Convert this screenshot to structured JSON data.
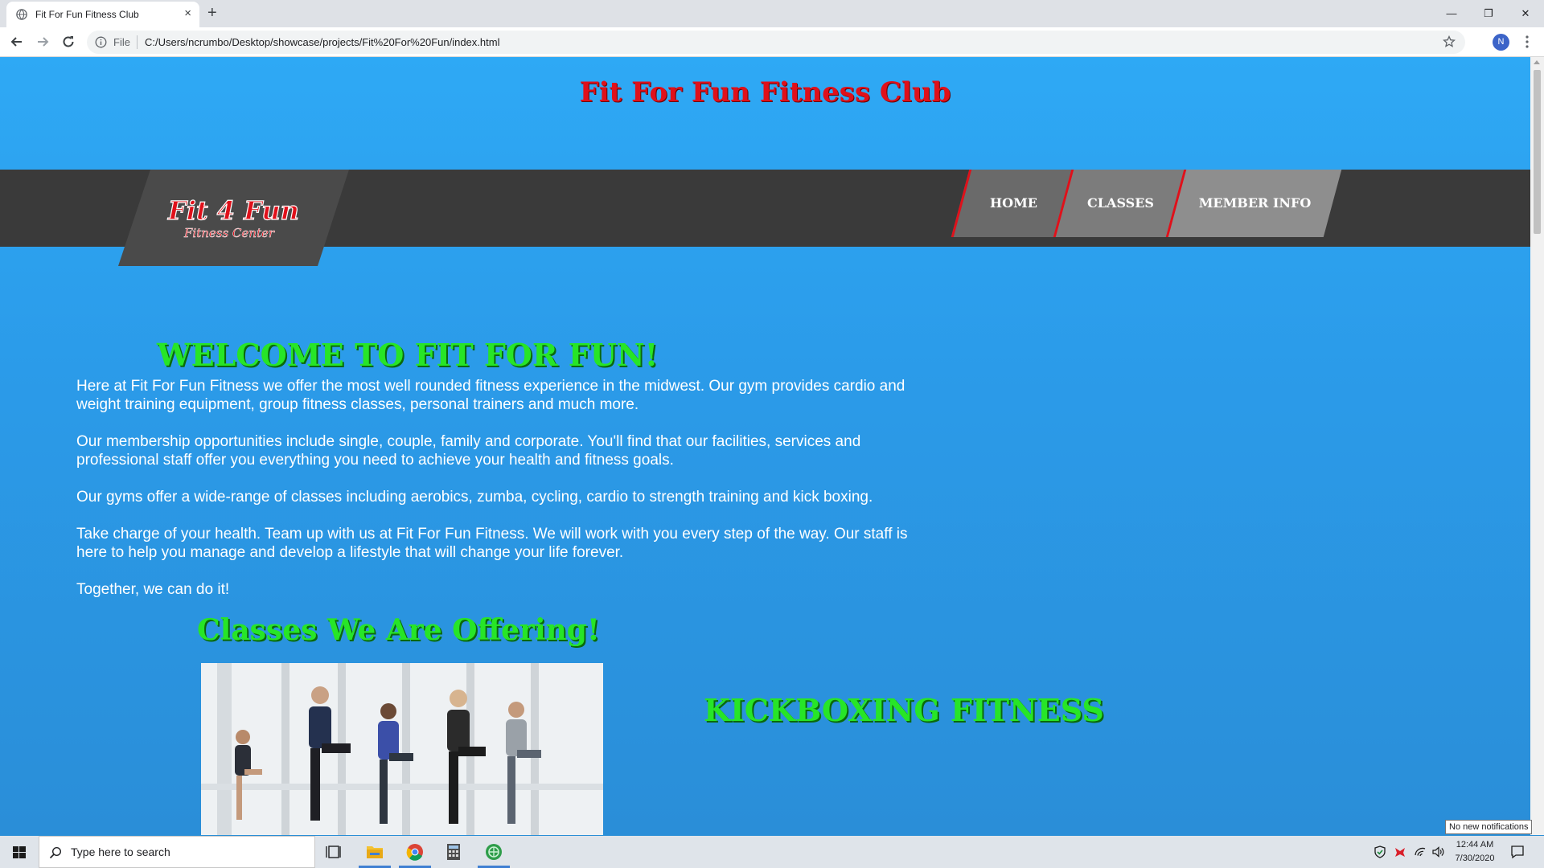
{
  "browser": {
    "tab_title": "Fit For Fun Fitness Club",
    "tab_close": "×",
    "new_tab": "+",
    "url_scheme": "File",
    "url": "C:/Users/ncrumbo/Desktop/showcase/projects/Fit%20For%20Fun/index.html",
    "profile_initial": "N",
    "window_controls": {
      "minimize": "—",
      "maximize": "❐",
      "close": "✕"
    }
  },
  "site": {
    "title": "Fit For Fun Fitness Club",
    "logo_text": "Fit 4 Fun",
    "logo_subtext": "Fitness Center",
    "nav": [
      "HOME",
      "CLASSES",
      "MEMBER INFO"
    ],
    "welcome_heading": "WELCOME TO FIT FOR FUN!",
    "paragraphs": [
      "Here at Fit For Fun Fitness we offer the most well rounded fitness experience in the midwest. Our gym provides cardio and weight training equipment, group fitness classes, personal trainers and much more.",
      "Our membership opportunities include single, couple, family and corporate. You'll find that our facilities, services and professional staff offer you everything you need to achieve your health and fitness goals.",
      "Our gyms offer a wide-range of classes including aerobics, zumba, cycling, cardio to strength training and kick boxing.",
      "Take charge of your health. Team up with us at Fit For Fun Fitness. We will work with you every step of the way. Our staff is here to help you manage and develop a lifestyle that will change your life forever.",
      "Together, we can do it!"
    ],
    "classes_heading": "Classes We Are Offering!",
    "class_name": "KICKBOXING FITNESS"
  },
  "notification_tooltip": "No new notifications",
  "taskbar": {
    "search_placeholder": "Type here to search",
    "time": "12:44 AM",
    "date": "7/30/2020"
  },
  "colors": {
    "page_bg": "#2ea9f5",
    "title_red": "#e0101a",
    "heading_green": "#27e527",
    "navbar": "#3a3a3a"
  }
}
